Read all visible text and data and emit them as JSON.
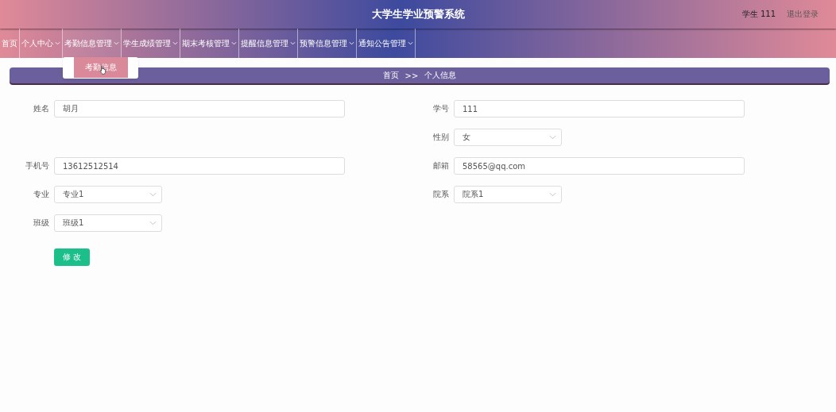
{
  "header": {
    "title": "大学生学业预警系统",
    "user": "学生 111",
    "logout": "退出登录"
  },
  "nav": [
    {
      "label": "首页",
      "dropdown": false,
      "selected": false
    },
    {
      "label": "个人中心",
      "dropdown": true,
      "selected": false
    },
    {
      "label": "考勤信息管理",
      "dropdown": true,
      "selected": true
    },
    {
      "label": "学生成绩管理",
      "dropdown": true,
      "selected": false
    },
    {
      "label": "期末考核管理",
      "dropdown": true,
      "selected": false
    },
    {
      "label": "提醒信息管理",
      "dropdown": true,
      "selected": false
    },
    {
      "label": "预警信息管理",
      "dropdown": true,
      "selected": false
    },
    {
      "label": "通知公告管理",
      "dropdown": true,
      "selected": false
    }
  ],
  "submenu": {
    "items": [
      {
        "label": "考勤信息",
        "selected": true
      }
    ]
  },
  "breadcrumb": {
    "home": "首页",
    "separator": ">>",
    "current": "个人信息"
  },
  "form": {
    "rows": [
      {
        "left": {
          "label": "姓名",
          "value": "胡月",
          "kind": "text"
        },
        "right": {
          "label": "学号",
          "value": "111",
          "kind": "text"
        }
      },
      {
        "right": {
          "label": "性别",
          "value": "女",
          "kind": "select"
        }
      },
      {
        "left": {
          "label": "手机号",
          "value": "13612512514",
          "kind": "text"
        },
        "right": {
          "label": "邮箱",
          "value": "58565@qq.com",
          "kind": "text"
        }
      },
      {
        "left": {
          "label": "专业",
          "value": "专业1",
          "kind": "select"
        },
        "right": {
          "label": "院系",
          "value": "院系1",
          "kind": "select"
        }
      },
      {
        "left": {
          "label": "班级",
          "value": "班级1",
          "kind": "select"
        }
      }
    ],
    "submit": "修 改"
  }
}
